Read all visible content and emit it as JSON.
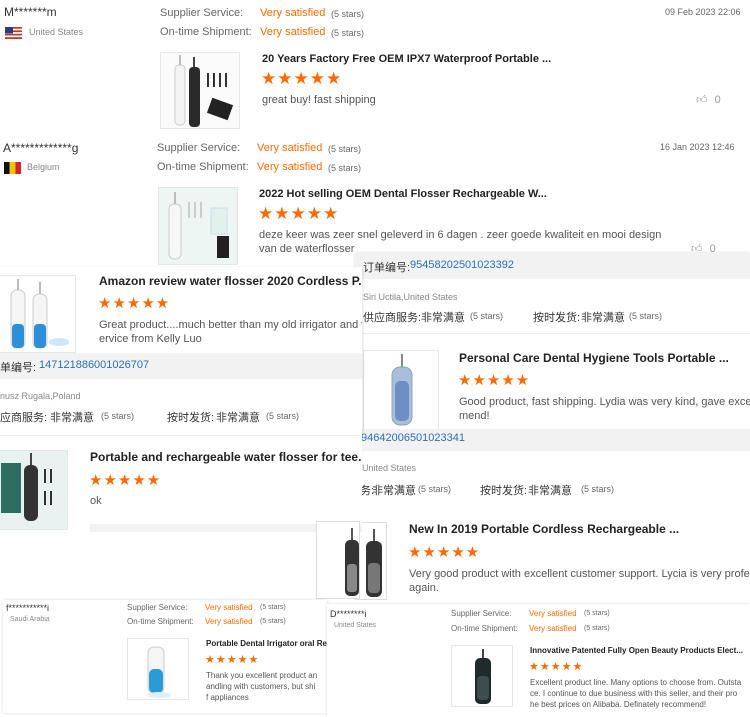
{
  "r1": {
    "name": "M*******m",
    "country": "United States",
    "supplier_label": "Supplier Service:",
    "supplier_value": "Very satisfied",
    "supplier_stars": "(5 stars)",
    "shipment_label": "On-time Shipment:",
    "shipment_value": "Very satisfied",
    "shipment_stars": "(5 stars)",
    "date": "09 Feb 2023 22:06",
    "product": "20 Years Factory Free OEM IPX7 Waterproof Portable ...",
    "stars": "★★★★★",
    "text": "great buy! fast shipping",
    "likes": "0"
  },
  "r2": {
    "name": "A*************g",
    "country": "Belgium",
    "supplier_label": "Supplier Service:",
    "supplier_value": "Very satisfied",
    "supplier_stars": "(5 stars)",
    "shipment_label": "On-time Shipment:",
    "shipment_value": "Very satisfied",
    "shipment_stars": "(5 stars)",
    "date": "16 Jan 2023 12:46",
    "product": "2022 Hot selling OEM Dental Flosser Rechargeable W...",
    "stars": "★★★★★",
    "text1": "deze keer was zeer snel geleverd in 6 dagen . zeer goede kwaliteit en mooi design",
    "text2": "van de waterflosser",
    "likes": "0"
  },
  "p3": {
    "product": "Amazon review water flosser 2020 Cordless P...",
    "stars": "★★★★★",
    "text1": "Great product....much better than my old irrigator and v",
    "text2": "ervice from Kelly Luo",
    "order_prefix": "单编号:",
    "order_no": "147121886001026707",
    "name": "nusz Rugala,Poland",
    "supplier_label": "应商服务:",
    "supplier_value": "非常满意",
    "supplier_stars": "(5 stars)",
    "shipment_label": "按时发货:",
    "shipment_value": "非常满意",
    "shipment_stars": "(5 stars)"
  },
  "p4": {
    "order_prefix": "订单编号:",
    "order_no": "95458202501023392",
    "name": "Siri Uctila,United States",
    "supplier_label": "供应商服务:",
    "supplier_value": "非常满意",
    "supplier_stars": "(5 stars)",
    "shipment_label": "按时发货:",
    "shipment_value": "非常满意",
    "shipment_stars": "(5 stars)",
    "product": "Personal Care Dental Hygiene Tools Portable ...",
    "stars": "★★★★★",
    "text1": "Good product, fast shipping. Lydia was very kind, gave excellent",
    "text2": "mend!",
    "order_no2": "94642006501023341"
  },
  "p5": {
    "product": "Portable and rechargeable water flosser for tee...",
    "stars": "★★★★★",
    "text": "ok"
  },
  "p6": {
    "country": "United States",
    "supplier_label": "务:",
    "supplier_value": "非常满意",
    "supplier_stars": "(5 stars)",
    "shipment_label": "按时发货:",
    "shipment_value": "非常满意",
    "shipment_stars": "(5 stars)",
    "product": "New In 2019 Portable Cordless Rechargeable ...",
    "stars": "★★★★★",
    "text1": "Very good product with excellent customer support. Lycia is very professional",
    "text2": "again."
  },
  "p7": {
    "name": "f***********i",
    "country": "Saudi Arabia",
    "supplier_label": "Supplier Service:",
    "supplier_value": "Very satisfied",
    "supplier_stars": "(5 stars)",
    "shipment_label": "On-time Shipment:",
    "shipment_value": "Very satisfied",
    "shipment_stars": "(5 stars)",
    "product": "Portable Dental Irrigator oral Re",
    "stars": "★★★★★",
    "text1": "Thank you excellent product an",
    "text2": "andling with customers, but shi",
    "text3": "f appliances"
  },
  "p8": {
    "name": "D********i",
    "country": "United States",
    "supplier_label": "Supplier Service:",
    "supplier_value": "Very satisfied",
    "supplier_stars": "(5 stars)",
    "shipment_label": "On-time Shipment:",
    "shipment_value": "Very satisfied",
    "shipment_stars": "(5 stars)",
    "product": "Innovative Patented Fully Open Beauty Products Elect...",
    "stars": "★★★★★",
    "text1": "Excellent product line. Many options to choose from. Outsta",
    "text2": "ce. I continue to due business with this seller, and their pro",
    "text3": "he best prices on Alibaba. Definately recommend!"
  },
  "colors": {
    "accent": "#ff6a00",
    "link": "#2a6ebb"
  }
}
